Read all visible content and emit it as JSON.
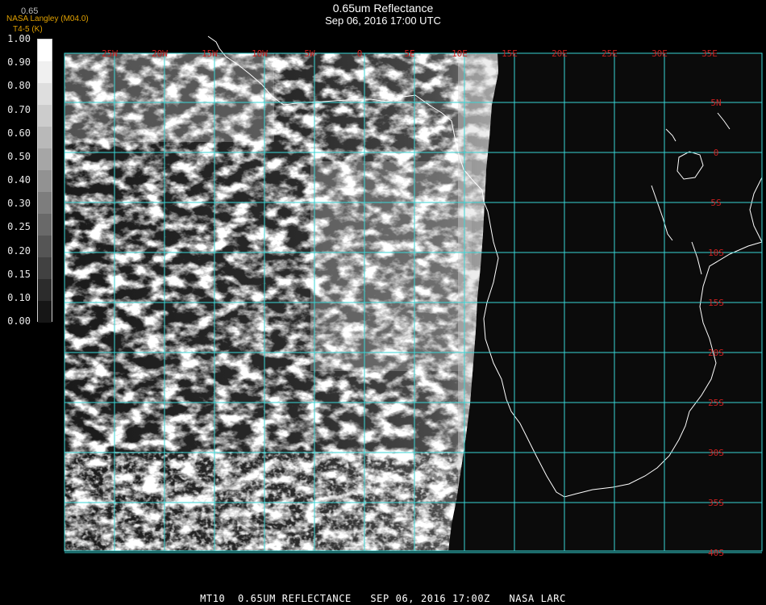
{
  "header": {
    "title": "0.65um Reflectance",
    "subtitle": "Sep 06, 2016 17:00 UTC",
    "credit_line_1": "NASA Langley (M04.0)",
    "credit_line_2": "T4-5 (K)",
    "faint_label": "0.65"
  },
  "colorbar": {
    "ticks": [
      "1.00",
      "0.90",
      "0.80",
      "0.70",
      "0.60",
      "0.50",
      "0.40",
      "0.30",
      "0.25",
      "0.20",
      "0.15",
      "0.10",
      "0.00"
    ],
    "gray_levels": [
      "#ffffff",
      "#f0f0f0",
      "#dedede",
      "#cccccc",
      "#b9b9b9",
      "#a6a6a6",
      "#929292",
      "#7d7d7d",
      "#696969",
      "#555555",
      "#414141",
      "#2c2c2c",
      "#161616"
    ]
  },
  "map": {
    "longitude_labels": [
      "25W",
      "20W",
      "15W",
      "10W",
      "5W",
      "0",
      "5E",
      "10E",
      "15E",
      "20E",
      "25E",
      "30E",
      "35E"
    ],
    "latitude_labels": [
      "5N",
      "0",
      "5S",
      "10S",
      "15S",
      "20S",
      "25S",
      "30S",
      "35S",
      "40S"
    ],
    "grid_color": "#38d6d6",
    "label_color": "#cc1f1f",
    "coastline_color": "#ffffff",
    "ocean_color": "#0b0b0b"
  },
  "footer": {
    "text": "MT10  0.65UM REFLECTANCE   SEP 06, 2016 17:00Z   NASA LARC"
  }
}
